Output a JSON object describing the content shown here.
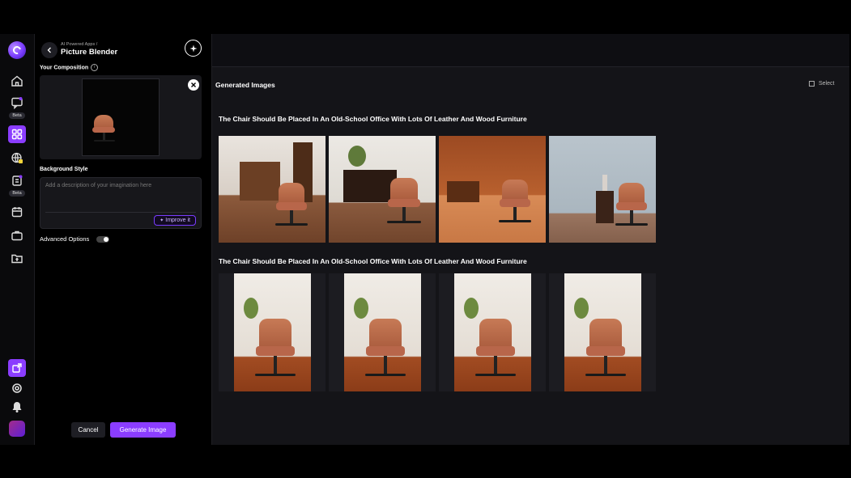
{
  "sidebar": {
    "beta_label": "Beta",
    "icons": [
      "logo",
      "home-icon",
      "chat-icon",
      "grid-icon",
      "globe-icon",
      "note-icon",
      "calendar-icon",
      "briefcase-icon",
      "folder-upload-icon",
      "share-icon",
      "settings-icon",
      "bell-icon",
      "avatar"
    ]
  },
  "panel": {
    "breadcrumb": "AI Powered Apps /",
    "title": "Picture Blender",
    "composition_label": "Your Composition",
    "background_style_label": "Background Style",
    "description_placeholder": "Add a description of your imagination here",
    "improve_label": "Improve it",
    "advanced_options_label": "Advanced Options",
    "cancel_label": "Cancel",
    "generate_label": "Generate Image"
  },
  "main": {
    "section_title": "Generated Images",
    "select_label": "Select",
    "groups": [
      {
        "prompt": "The Chair Should Be Placed In An Old-School Office With Lots Of Leather And Wood Furniture",
        "image_count": 4
      },
      {
        "prompt": "The Chair Should Be Placed In An Old-School Office With Lots Of Leather And Wood Furniture",
        "image_count": 4
      }
    ]
  },
  "colors": {
    "accent": "#8b3dff",
    "panel_bg": "#000000",
    "main_bg": "#141418",
    "chair": "#b8664a"
  }
}
